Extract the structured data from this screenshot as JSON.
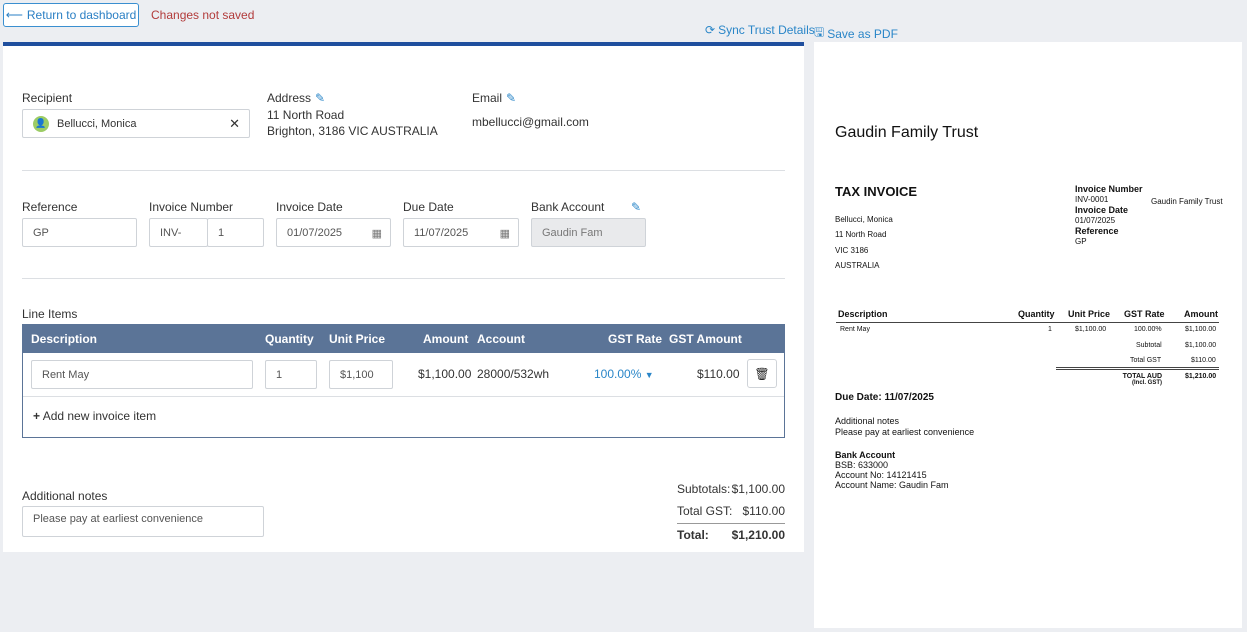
{
  "topbar": {
    "back_label": "Return to dashboard",
    "unsaved": "Changes not saved",
    "sync_label": "Sync Trust Details",
    "pdf_label": "Save as PDF"
  },
  "recipient": {
    "label": "Recipient",
    "name": "Bellucci, Monica"
  },
  "address": {
    "label": "Address",
    "line1": "11 North Road",
    "line2": "Brighton, 3186 VIC AUSTRALIA"
  },
  "email": {
    "label": "Email",
    "value": "mbellucci@gmail.com"
  },
  "fields": {
    "reference_label": "Reference",
    "reference_value": "GP",
    "invnum_label": "Invoice Number",
    "invnum_prefix": "INV-",
    "invnum_value": "1",
    "invdate_label": "Invoice Date",
    "invdate_value": "01/07/2025",
    "duedate_label": "Due Date",
    "duedate_value": "11/07/2025",
    "bank_label": "Bank Account",
    "bank_value": "Gaudin Fam"
  },
  "line_items": {
    "title": "Line Items",
    "headers": {
      "description": "Description",
      "quantity": "Quantity",
      "unit_price": "Unit Price",
      "amount": "Amount",
      "account": "Account",
      "gst_rate": "GST Rate",
      "gst_amount": "GST Amount"
    },
    "rows": [
      {
        "description": "Rent May",
        "quantity": "1",
        "unit_price": "$1,100",
        "amount": "$1,100.00",
        "account": "28000/532wh",
        "gst_rate": "100.00%",
        "gst_amount": "$110.00"
      }
    ],
    "add_label": "Add new invoice item"
  },
  "notes": {
    "label": "Additional notes",
    "value": "Please pay at earliest convenience"
  },
  "totals": {
    "subtotal_label": "Subtotals:",
    "subtotal_value": "$1,100.00",
    "gst_label": "Total GST:",
    "gst_value": "$110.00",
    "total_label": "Total:",
    "total_value": "$1,210.00"
  },
  "preview": {
    "trust_name": "Gaudin Family Trust",
    "doc_title": "TAX INVOICE",
    "to_name": "Bellucci, Monica",
    "to_line1": "11 North Road",
    "to_line2": "VIC 3186",
    "to_line3": "AUSTRALIA",
    "invnum_label": "Invoice Number",
    "invnum_value": "INV-0001",
    "invdate_label": "Invoice Date",
    "invdate_value": "01/07/2025",
    "ref_label": "Reference",
    "ref_value": "GP",
    "from_name": "Gaudin Family Trust",
    "th_description": "Description",
    "th_quantity": "Quantity",
    "th_unit_price": "Unit Price",
    "th_gst_rate": "GST Rate",
    "th_amount": "Amount",
    "row_description": "Rent May",
    "row_quantity": "1",
    "row_unit_price": "$1,100.00",
    "row_gst_rate": "100.00%",
    "row_amount": "$1,100.00",
    "subtotal_label": "Subtotal",
    "subtotal_value": "$1,100.00",
    "gst_label": "Total GST",
    "gst_value": "$110.00",
    "total_label": "TOTAL AUD",
    "total_sub": "(Incl. GST)",
    "total_value": "$1,210.00",
    "due": "Due Date: 11/07/2025",
    "notes_label": "Additional notes",
    "notes_value": "Please pay at earliest convenience",
    "bank_label": "Bank Account",
    "bsb": "BSB: 633000",
    "acct_no": "Account No: 14121415",
    "acct_name": "Account Name: Gaudin Fam"
  },
  "colors": {
    "accent": "#1f4f9e",
    "table_header": "#5b7497",
    "link": "#2a86c8",
    "warning": "#b23b3b"
  },
  "icons": {
    "back": "arrow-left-icon",
    "sync": "sync-icon",
    "pdf": "save-icon",
    "edit": "pencil-icon",
    "calendar": "calendar-icon",
    "delete": "trash-icon",
    "add": "plus-icon"
  }
}
